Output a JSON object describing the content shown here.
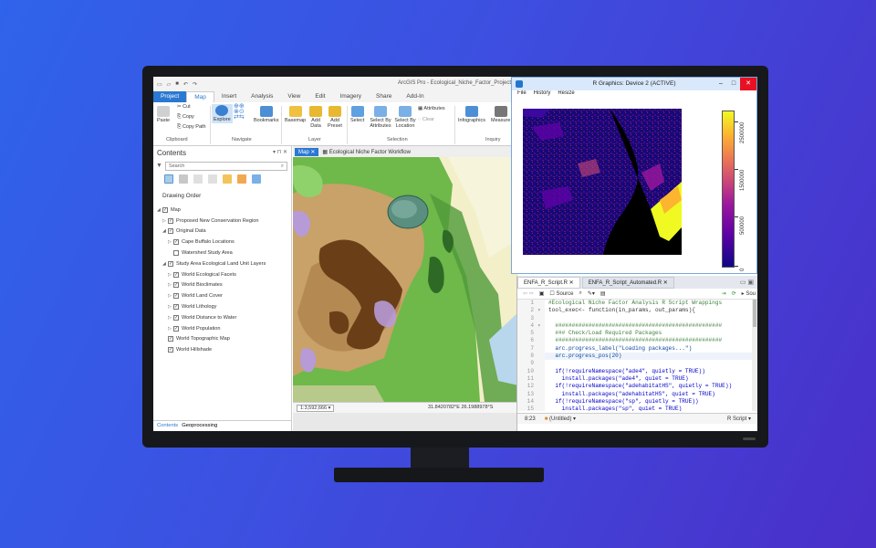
{
  "arcgis": {
    "title": "ArcGIS Pro - Ecological_Niche_Factor_Project - ",
    "tabs": [
      "Project",
      "Map",
      "Insert",
      "Analysis",
      "View",
      "Edit",
      "Imagery",
      "Share",
      "Add-In"
    ],
    "active_tab": "Map",
    "ribbon": {
      "paste": "Paste",
      "cut": "Cut",
      "copy": "Copy",
      "copy_path": "Copy Path",
      "clipboard": "Clipboard",
      "explore": "Explore",
      "bookmarks": "Bookmarks",
      "navigate": "Navigate",
      "basemap": "Basemap",
      "add_data": "Add Data",
      "add_preset": "Add Preset",
      "layer": "Layer",
      "select": "Select",
      "select_by_attributes": "Select By Attributes",
      "select_by_location": "Select By Location",
      "attributes": "Attributes",
      "clear": "Clear",
      "selection": "Selection",
      "infographics": "Infographics",
      "measure": "Measure",
      "inquiry": "Inquiry"
    },
    "contents": {
      "title": "Contents",
      "search_placeholder": "Search",
      "drawing_order": "Drawing Order",
      "layers": [
        {
          "label": "Map",
          "indent": 0,
          "arrow": "◢",
          "checked": true
        },
        {
          "label": "Proposed New Conservation Region",
          "indent": 1,
          "arrow": "▷",
          "checked": true
        },
        {
          "label": "Original Data",
          "indent": 1,
          "arrow": "◢",
          "checked": true
        },
        {
          "label": "Cape Buffalo Locations",
          "indent": 2,
          "arrow": "▷",
          "checked": true
        },
        {
          "label": "Watershed Study Area",
          "indent": 2,
          "arrow": "",
          "checked": false
        },
        {
          "label": "Study Area Ecological Land Unit Layers",
          "indent": 1,
          "arrow": "◢",
          "checked": true
        },
        {
          "label": "World Ecological Facets",
          "indent": 2,
          "arrow": "▷",
          "checked": true
        },
        {
          "label": "World Bioclimates",
          "indent": 2,
          "arrow": "▷",
          "checked": true
        },
        {
          "label": "World Land Cover",
          "indent": 2,
          "arrow": "▷",
          "checked": true
        },
        {
          "label": "World Lithology",
          "indent": 2,
          "arrow": "▷",
          "checked": true
        },
        {
          "label": "World Distance to Water",
          "indent": 2,
          "arrow": "▷",
          "checked": true
        },
        {
          "label": "World Population",
          "indent": 2,
          "arrow": "▷",
          "checked": true
        },
        {
          "label": "World Topographic Map",
          "indent": 1,
          "arrow": "",
          "checked": true
        },
        {
          "label": "World Hillshade",
          "indent": 1,
          "arrow": "",
          "checked": true
        }
      ],
      "footer_tabs": [
        "Contents",
        "Geoprocessing"
      ]
    },
    "map_tabs": [
      "Map",
      "Ecological Niche Factor Workflow"
    ],
    "scale": "1:3,592,666",
    "coordinates": "31.8420782°E 26.1988978°S"
  },
  "rgraphics": {
    "title": "R Graphics: Device 2 (ACTIVE)",
    "menu": [
      "File",
      "History",
      "Resize"
    ],
    "legend_labels": [
      "2500000",
      "1500000",
      "500000",
      "0"
    ]
  },
  "rstudio": {
    "tabs": [
      "ENFA_R_Script.R",
      "ENFA_R_Script_Automated.R"
    ],
    "source_label": "Source",
    "code_lines": [
      {
        "n": "1",
        "text": "#Ecological Niche Factor Analysis R Script Wrappings",
        "cls": "cm",
        "fold": ""
      },
      {
        "n": "2",
        "text": "tool_exec<- function(in_params, out_params){",
        "cls": "fn",
        "fold": "▾"
      },
      {
        "n": "3",
        "text": "",
        "cls": "fn",
        "fold": ""
      },
      {
        "n": "4",
        "text": "  ##################################################",
        "cls": "cm",
        "fold": "▾"
      },
      {
        "n": "5",
        "text": "  ### Check/Load Required Packages",
        "cls": "cm",
        "fold": ""
      },
      {
        "n": "6",
        "text": "  ##################################################",
        "cls": "cm",
        "fold": ""
      },
      {
        "n": "7",
        "text": "  arc.progress_label(\"Loading packages...\")",
        "cls": "st",
        "fold": ""
      },
      {
        "n": "8",
        "text": "  arc.progress_pos(20)",
        "cls": "st",
        "fold": ""
      },
      {
        "n": "9",
        "text": "",
        "cls": "fn",
        "fold": ""
      },
      {
        "n": "10",
        "text": "  if(!requireNamespace(\"ade4\", quietly = TRUE))",
        "cls": "kw",
        "fold": ""
      },
      {
        "n": "11",
        "text": "    install.packages(\"ade4\", quiet = TRUE)",
        "cls": "kw",
        "fold": ""
      },
      {
        "n": "12",
        "text": "  if(!requireNamespace(\"adehabitatHS\", quietly = TRUE))",
        "cls": "kw",
        "fold": ""
      },
      {
        "n": "13",
        "text": "    install.packages(\"adehabitatHS\", quiet = TRUE)",
        "cls": "kw",
        "fold": ""
      },
      {
        "n": "14",
        "text": "  if(!requireNamespace(\"sp\", quietly = TRUE))",
        "cls": "kw",
        "fold": ""
      },
      {
        "n": "15",
        "text": "    install.packages(\"sp\", quiet = TRUE)",
        "cls": "kw",
        "fold": ""
      }
    ],
    "cursor_pos": "8:23",
    "scope": "(Untitled)",
    "filetype": "R Script"
  }
}
